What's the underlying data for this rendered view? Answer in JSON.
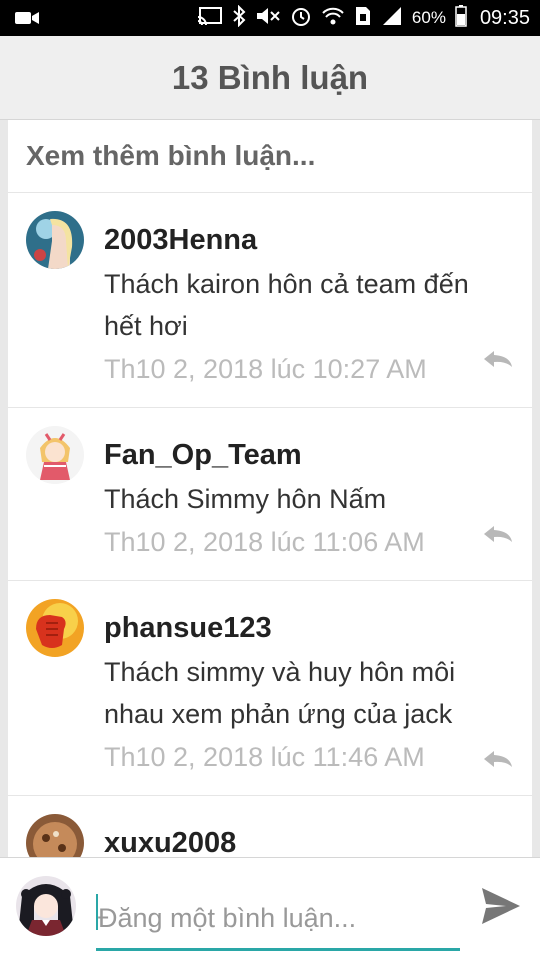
{
  "status_bar": {
    "icons": [
      "video-icon",
      "cast-icon",
      "bluetooth-icon",
      "mute-icon",
      "alarm-icon",
      "wifi-icon",
      "sim-icon",
      "signal-icon",
      "battery-icon"
    ],
    "battery": "60%",
    "time": "09:35"
  },
  "header": {
    "title": "13 Bình luận"
  },
  "comments_panel": {
    "see_more": "Xem thêm bình luận...",
    "comments": [
      {
        "user": "2003Henna",
        "text": "Thách kairon hôn cả team đến hết hơi",
        "time": "Th10 2, 2018 lúc 10:27 AM",
        "avatar": "anime-avatar"
      },
      {
        "user": "Fan_Op_Team",
        "text": "Thách Simmy hôn Nấm",
        "time": "Th10 2, 2018 lúc 11:06 AM",
        "avatar": "chibi-avatar"
      },
      {
        "user": "phansue123",
        "text": "Thách simmy và huy hôn môi nhau xem phản ứng của jack",
        "time": "Th10 2, 2018 lúc 11:46 AM",
        "avatar": "fist-avatar"
      },
      {
        "user": "xuxu2008",
        "text": "",
        "time": "",
        "avatar": "cookie-avatar"
      }
    ]
  },
  "input_bar": {
    "placeholder": "Đăng một bình luận...",
    "value": ""
  },
  "colors": {
    "accent": "#2aa7a7",
    "header_bg": "#efefef",
    "status_bg": "#000000",
    "time_text": "#bbbbbb"
  }
}
